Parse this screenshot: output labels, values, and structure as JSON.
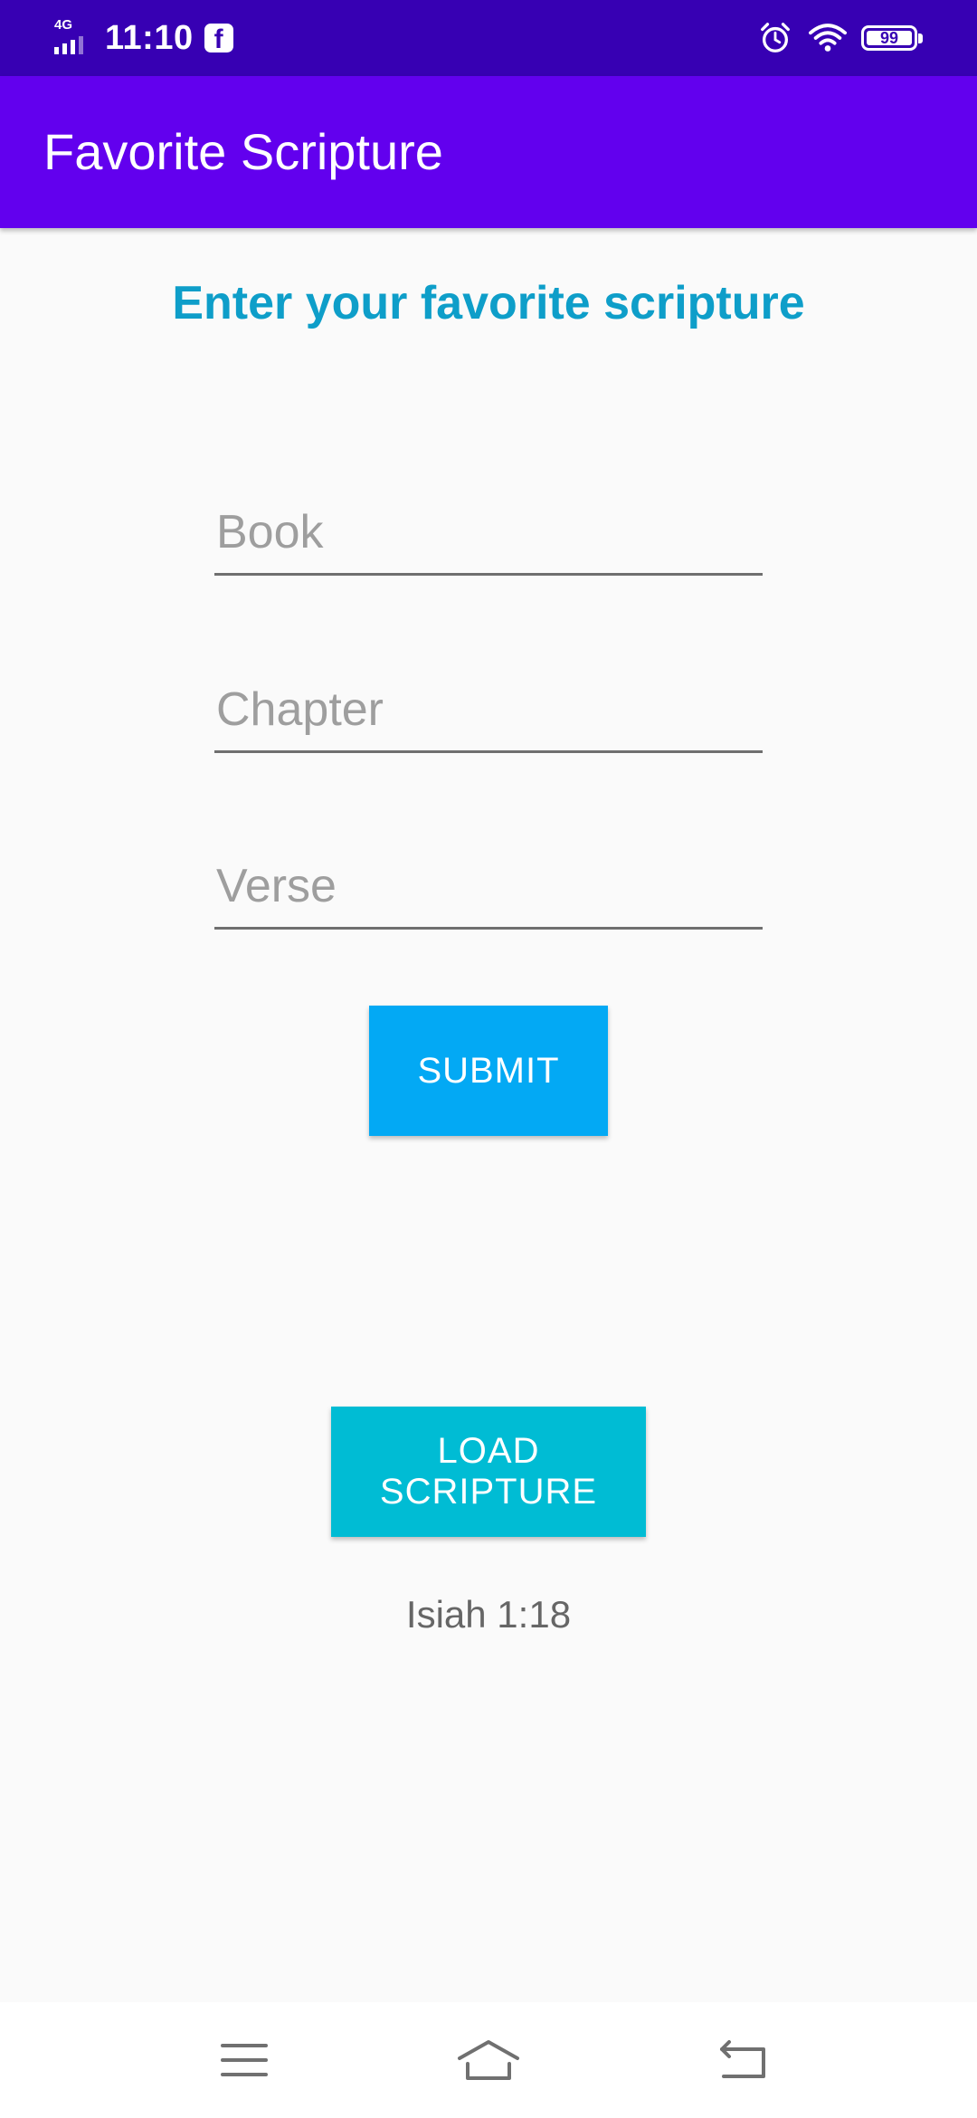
{
  "status_bar": {
    "network": "4G",
    "time": "11:10",
    "battery": "99",
    "icons": [
      "signal-icon",
      "facebook-icon",
      "alarm-icon",
      "wifi-icon",
      "battery-icon"
    ]
  },
  "app_bar": {
    "title": "Favorite Scripture"
  },
  "main": {
    "heading": "Enter your favorite scripture",
    "book_field": {
      "placeholder": "Book",
      "value": ""
    },
    "chapter_field": {
      "placeholder": "Chapter",
      "value": ""
    },
    "verse_field": {
      "placeholder": "Verse",
      "value": ""
    },
    "submit_label": "SUBMIT",
    "load_label": "LOAD SCRIPTURE",
    "loaded_scripture": "Isiah 1:18"
  },
  "nav_bar": {
    "icons": [
      "menu-icon",
      "home-icon",
      "back-icon"
    ]
  },
  "colors": {
    "status_bar": "#3700b3",
    "app_bar": "#6200ee",
    "heading": "#0e9ec9",
    "submit_button": "#03a9f4",
    "load_button": "#00bcd4",
    "background": "#fafafa"
  }
}
